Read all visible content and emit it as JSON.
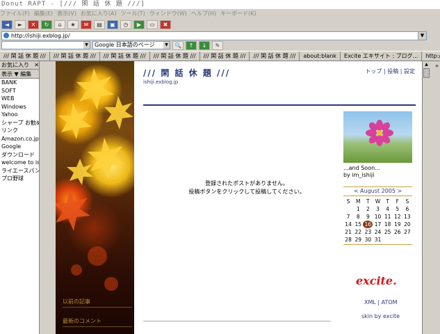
{
  "app": {
    "title": "Donut RAPT - [/// 閑 話 休 題 ///]"
  },
  "menu": [
    "ファイル(F)",
    "編集(E)",
    "表示(V)",
    "お気に入り(A)",
    "ツール(T)",
    "ウィンドウ(W)",
    "ヘルプ(H)",
    "キーボード(K)"
  ],
  "address": {
    "url": "http://ishiji.exblog.jp/"
  },
  "search": {
    "engine": "Google 日本語のページ"
  },
  "tabs": [
    "/// 閑 話 休 題 ///",
    "/// 閑 話 休 題 ///",
    "/// 閑 話 休 題 ///",
    "/// 閑 話 休 題 ///",
    "/// 閑 話 休 題 ///",
    "/// 閑 話 休 題 ///",
    "about:blank",
    "Excite エキサイト : ブログ...",
    "http://www.goo..."
  ],
  "sidebar": {
    "header": "お気に入り",
    "view_label": "表示",
    "edit_label": "編集",
    "items": [
      "BANK",
      "SOFT",
      "WEB",
      "Windows",
      "Yahoo",
      "シャープ お勧め",
      "リンク",
      "Amazon.co.jp ア",
      "Google",
      "ダウンロード",
      "welcome to ishi",
      "ライエースパン 多",
      "プロ野球"
    ]
  },
  "blog": {
    "title": "/// 閑 話 休 題 ///",
    "url": "ishiji.exblog.jp",
    "nav": "トップ | 投稿 | 設定",
    "no_posts_line1": "登録されたポストがありません。",
    "no_posts_line2": "投稿ボタンをクリックして投稿してください。",
    "left_label1": "以前の記事",
    "left_label2": "最新のコメント",
    "photo_caption_line1": "...and Soon...",
    "photo_caption_line2": "by im_ishiji",
    "calendar": {
      "title": "< August 2005 >",
      "days": [
        "S",
        "M",
        "T",
        "W",
        "T",
        "F",
        "S"
      ],
      "weeks": [
        [
          "",
          "1",
          "2",
          "3",
          "4",
          "5",
          "6"
        ],
        [
          "7",
          "8",
          "9",
          "10",
          "11",
          "12",
          "13"
        ],
        [
          "14",
          "15",
          "16",
          "17",
          "18",
          "19",
          "20"
        ],
        [
          "21",
          "22",
          "23",
          "24",
          "25",
          "26",
          "27"
        ],
        [
          "28",
          "29",
          "30",
          "31",
          "",
          "",
          ""
        ]
      ],
      "today": "16"
    },
    "logo_text": "excite.",
    "xml_links": "XML | ATOM",
    "skin_text": "skin by excite"
  },
  "colors": {
    "accent": "#2a3a7a",
    "gold": "#c8a040",
    "excite_red": "#d4181a"
  }
}
